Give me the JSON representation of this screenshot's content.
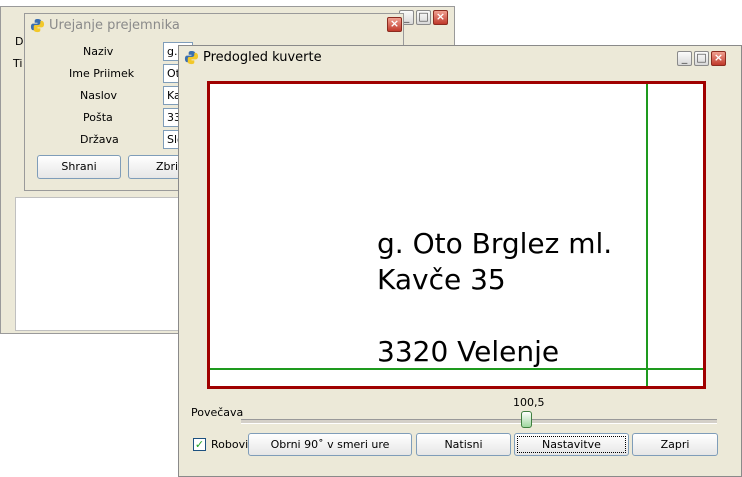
{
  "main_window": {
    "menu_first_letter": "D",
    "label_first_letters": "Ti"
  },
  "edit_window": {
    "title": "Urejanje prejemnika",
    "fields": [
      {
        "label": "Naziv",
        "value": "g."
      },
      {
        "label": "Ime Priimek",
        "value": "Ot"
      },
      {
        "label": "Naslov",
        "value": "Ka"
      },
      {
        "label": "Pošta",
        "value": "33"
      },
      {
        "label": "Država",
        "value": "Slo"
      }
    ],
    "save_label": "Shrani",
    "delete_label": "Zbriš"
  },
  "preview_window": {
    "title": "Predogled kuverte",
    "envelope": {
      "line1": "g. Oto Brglez ml.",
      "line2": "Kavče 35",
      "line3": "",
      "line4": "3320 Velenje"
    },
    "zoom": {
      "label": "Povečava",
      "value_text": "100,5",
      "fraction": 0.6
    },
    "edges_checkbox": {
      "label": "Robovi",
      "checked": true
    },
    "buttons": {
      "rotate": "Obrni 90˚ v smeri ure",
      "print": "Natisni",
      "settings": "Nastavitve",
      "close": "Zapri"
    }
  },
  "colors": {
    "border_red": "#a00000",
    "guide_green": "#1e9a1e",
    "window_bg": "#ece9d8"
  }
}
